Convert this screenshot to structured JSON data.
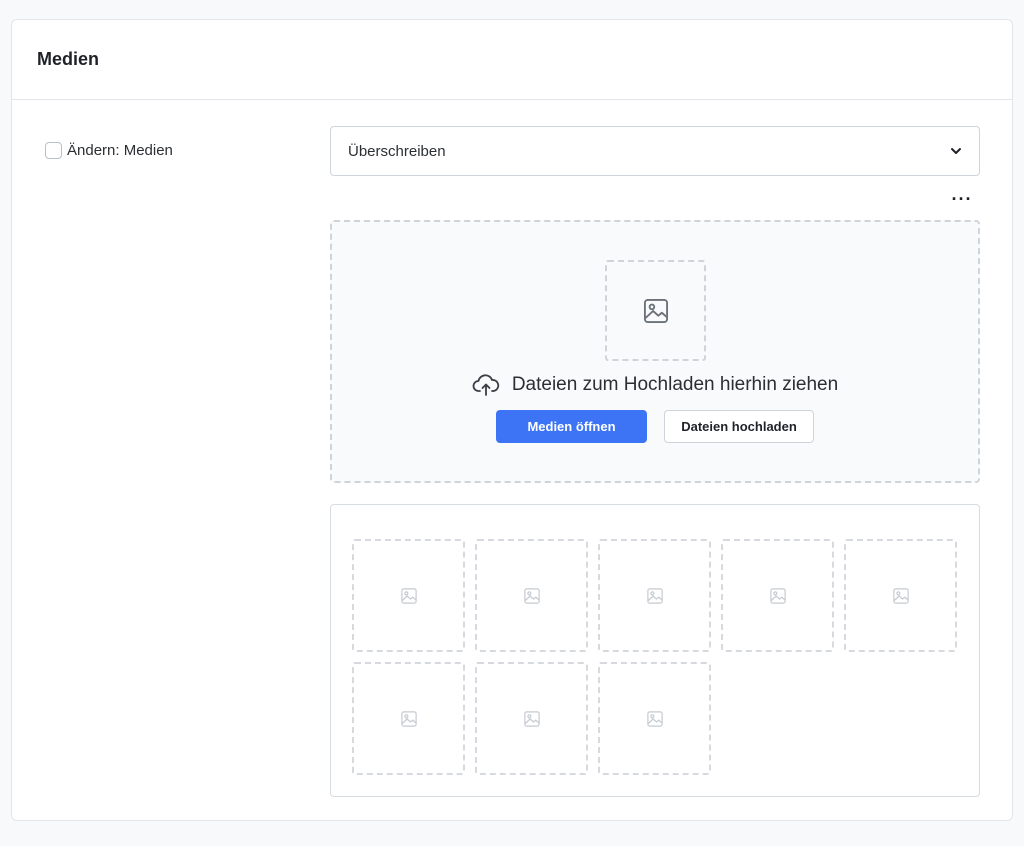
{
  "section": {
    "title": "Medien"
  },
  "field": {
    "checkbox_label": "Ändern: Medien",
    "checked": false
  },
  "mode_select": {
    "selected": "Überschreiben"
  },
  "more_menu": {
    "label": "···"
  },
  "dropzone": {
    "instruction": "Dateien zum Hochladen hierhin ziehen",
    "open_media_label": "Medien öffnen",
    "upload_files_label": "Dateien hochladen"
  },
  "gallery": {
    "placeholder_count": 8
  },
  "colors": {
    "primary": "#3d74f5",
    "border": "#ced4da",
    "dropzone_bg": "#f8fafc"
  }
}
